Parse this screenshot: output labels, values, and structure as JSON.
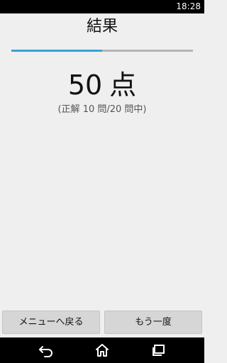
{
  "status_bar": {
    "time": "18:28"
  },
  "title": "結果",
  "progress": {
    "fraction": 0.5,
    "fill_color": "#33a3d6",
    "track_color": "#b5b5b5"
  },
  "score": {
    "value": "50",
    "unit": "点"
  },
  "detail": "(正解 10 問/20 問中)",
  "buttons": {
    "menu_label": "メニューへ戻る",
    "retry_label": "もう一度"
  },
  "nav": {
    "icons": [
      "back-icon",
      "home-icon",
      "recent-apps-icon"
    ]
  }
}
